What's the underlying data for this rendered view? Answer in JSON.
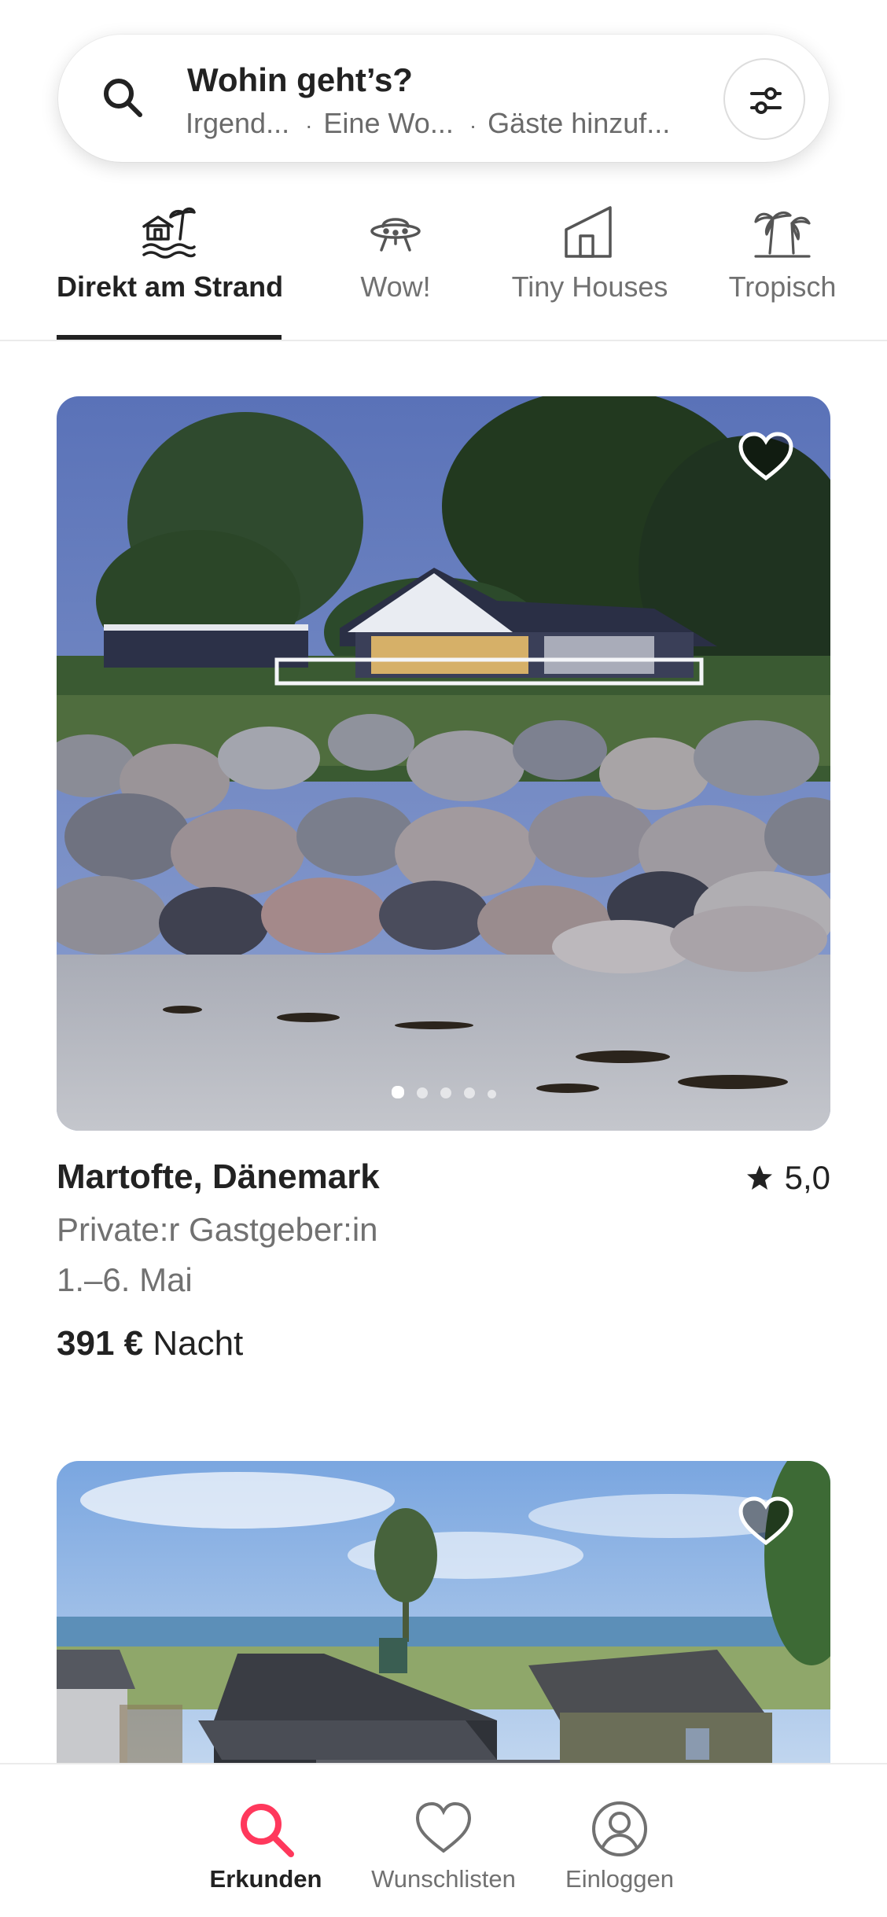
{
  "search": {
    "title": "Wohin geht’s?",
    "where": "Irgend...",
    "when": "Eine Wo...",
    "guests": "Gäste hinzuf...",
    "separator": "·"
  },
  "categories": [
    {
      "label": "Direkt am Strand",
      "icon": "beachfront-icon",
      "active": true
    },
    {
      "label": "Wow!",
      "icon": "ufo-icon",
      "active": false
    },
    {
      "label": "Tiny Houses",
      "icon": "tiny-house-icon",
      "active": false
    },
    {
      "label": "Tropisch",
      "icon": "palm-trees-icon",
      "active": false
    }
  ],
  "listings": [
    {
      "title": "Martofte, Dänemark",
      "rating": "5,0",
      "host": "Private:r Gastgeber:in",
      "dates": "1.–6. Mai",
      "price": "391 €",
      "price_unit": "Nacht",
      "photo_count": 5,
      "photo_index": 1
    }
  ],
  "bottom_nav": [
    {
      "label": "Erkunden",
      "icon": "search-icon",
      "active": true
    },
    {
      "label": "Wunschlisten",
      "icon": "heart-icon",
      "active": false
    },
    {
      "label": "Einloggen",
      "icon": "profile-icon",
      "active": false
    }
  ],
  "colors": {
    "accent": "#ff385c",
    "text": "#222222",
    "muted": "#717171"
  }
}
